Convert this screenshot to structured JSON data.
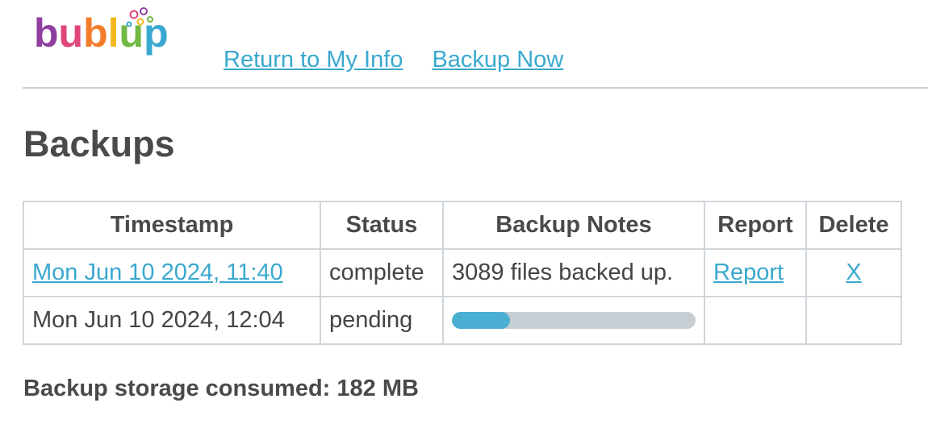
{
  "brand": {
    "logo_text": "bublup",
    "colors": {
      "b1": "#8e3fa0",
      "u": "#e0457b",
      "b2": "#f47d2c",
      "l": "#f2b81e",
      "u2": "#71b944",
      "p": "#3aa8cf"
    }
  },
  "nav": {
    "return_label": "Return to My Info",
    "backup_now_label": "Backup Now"
  },
  "page": {
    "title": "Backups"
  },
  "table": {
    "headers": {
      "timestamp": "Timestamp",
      "status": "Status",
      "notes": "Backup Notes",
      "report": "Report",
      "delete": "Delete"
    },
    "rows": [
      {
        "timestamp": "Mon Jun 10 2024, 11:40",
        "status": "complete",
        "notes": "3089 files backed up.",
        "report": "Report",
        "delete": "X"
      },
      {
        "timestamp": "Mon Jun 10 2024, 12:04",
        "status": "pending",
        "progress_fraction": 0.24
      }
    ]
  },
  "footer": {
    "storage_text": "Backup storage consumed: 182 MB"
  },
  "colors": {
    "link": "#3aa8cf",
    "progress_fill": "#4bafd3",
    "progress_track": "#c6ced4"
  }
}
